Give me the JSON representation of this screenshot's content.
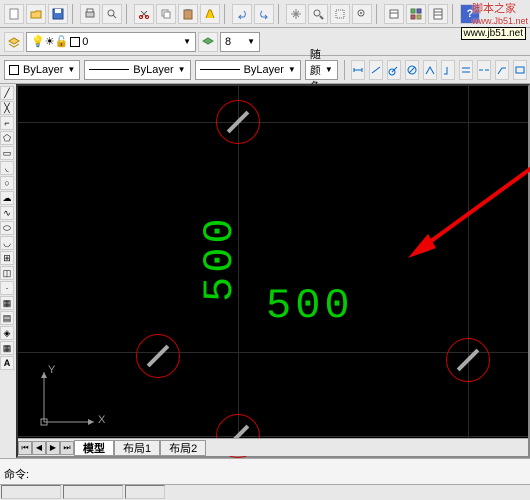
{
  "watermark": "脚本之家",
  "watermark_url": "www.Jb51.net",
  "help_hint": "www.jb51.net",
  "layer": {
    "combo_value": "0",
    "layer_num": "8"
  },
  "props": {
    "color": "ByLayer",
    "linetype": "ByLayer",
    "lineweight": "ByLayer",
    "plotstyle": "随颜色"
  },
  "canvas": {
    "text_h": "500",
    "text_v": "500",
    "axis_x": "X",
    "axis_y": "Y"
  },
  "tabs": {
    "model": "模型",
    "layout1": "布局1",
    "layout2": "布局2"
  },
  "command": {
    "prompt": "命令:"
  }
}
